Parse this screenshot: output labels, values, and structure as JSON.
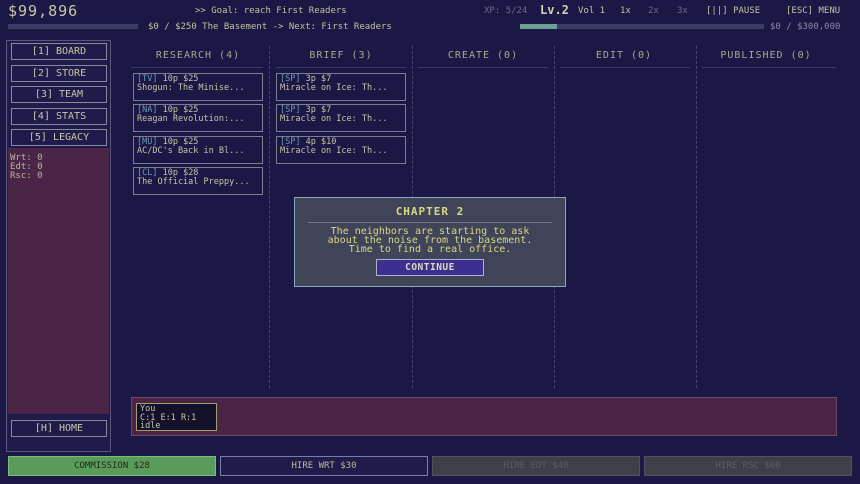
{
  "header": {
    "money": "$99,896",
    "goal": ">> Goal: reach First Readers",
    "xp": "XP: 5/24",
    "level": "Lv.2",
    "volume": "Vol 1",
    "speeds": [
      "1x",
      "2x",
      "3x"
    ],
    "pause": "[||] PAUSE",
    "menu": "[ESC] MENU",
    "progress_left_label": "$0 / $250 The Basement -> Next: First Readers",
    "progress_left_fraction": 0,
    "progress_right_label": "$0 / $300,000",
    "progress_right_fraction": 0.15
  },
  "sidebar": {
    "nav": [
      {
        "label": "[1] BOARD"
      },
      {
        "label": "[2] STORE"
      },
      {
        "label": "[3] TEAM"
      },
      {
        "label": "[4] STATS"
      },
      {
        "label": "[5] LEGACY"
      }
    ],
    "stats": [
      "Wrt: 0",
      "Edt: 0",
      "Rsc: 0"
    ],
    "home": "[H] HOME"
  },
  "board": {
    "columns": [
      {
        "label": "RESEARCH (4)"
      },
      {
        "label": "BRIEF (3)"
      },
      {
        "label": "CREATE (0)"
      },
      {
        "label": "EDIT (0)"
      },
      {
        "label": "PUBLISHED (0)"
      }
    ],
    "research_cards": [
      {
        "tag": "[TV]",
        "meta": " 10p $25",
        "title": "Shogun: The Minise..."
      },
      {
        "tag": "[NA]",
        "meta": " 10p $25",
        "title": "Reagan Revolution:..."
      },
      {
        "tag": "[MU]",
        "meta": " 10p $25",
        "title": "AC/DC's Back in Bl..."
      },
      {
        "tag": "[CL]",
        "meta": " 10p $28",
        "title": "The Official Preppy..."
      }
    ],
    "brief_cards": [
      {
        "tag": "[SP]",
        "meta": " 3p $7",
        "title": "Miracle on Ice: Th..."
      },
      {
        "tag": "[SP]",
        "meta": " 3p $7",
        "title": "Miracle on Ice: Th..."
      },
      {
        "tag": "[SP]",
        "meta": " 4p $10",
        "title": "Miracle on Ice: Th..."
      }
    ]
  },
  "staff": {
    "name": "You",
    "stats": "C:1 E:1 R:1",
    "status": "idle"
  },
  "actions": {
    "commission": "COMMISSION $28",
    "hire_wrt": "HIRE WRT $30",
    "hire_edt": "HIRE EDT $40",
    "hire_rsc": "HIRE RSC $60"
  },
  "modal": {
    "title": "CHAPTER 2",
    "lines": [
      "The neighbors are starting to ask",
      "about the noise from the basement.",
      "Time to find a real office."
    ],
    "button": "CONTINUE"
  }
}
